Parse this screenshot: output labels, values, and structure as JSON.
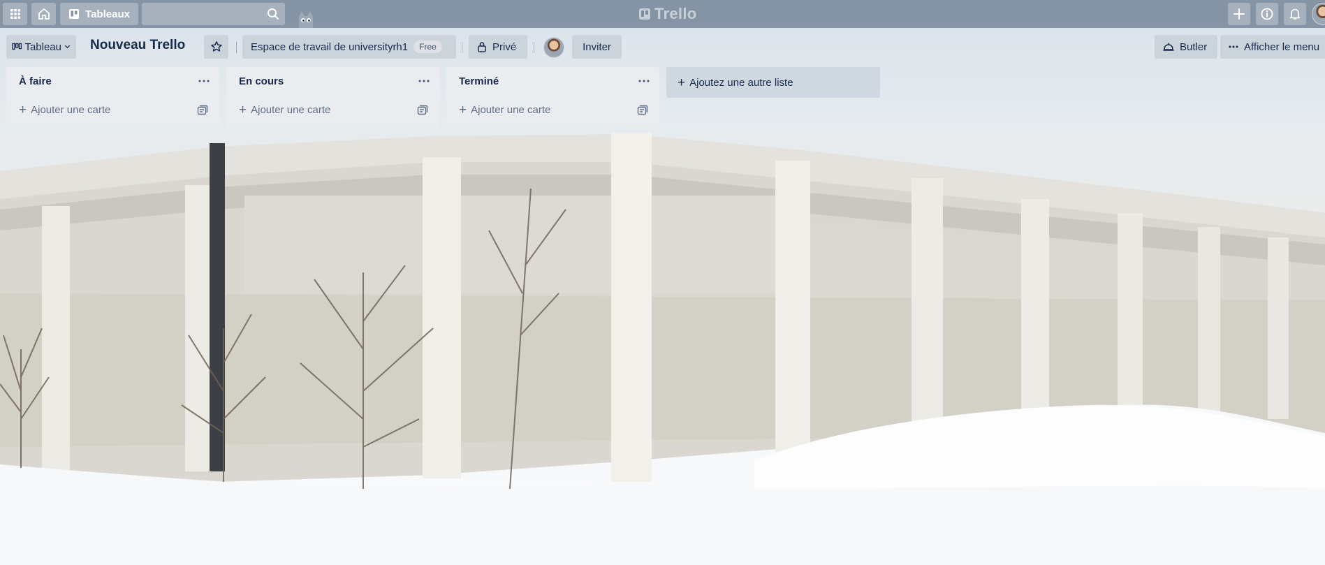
{
  "topbar": {
    "boards_label": "Tableaux",
    "search_value": "",
    "logo_text": "Trello",
    "icons": [
      "apps-grid-icon",
      "home-icon",
      "boards-icon",
      "search-icon",
      "create-plus-icon",
      "info-icon",
      "notifications-bell-icon"
    ]
  },
  "board_header": {
    "view_label": "Tableau",
    "title": "Nouveau Trello",
    "workspace_label": "Espace de travail de universityrh1",
    "workspace_badge": "Free",
    "visibility_label": "Privé",
    "invite_label": "Inviter",
    "butler_label": "Butler",
    "show_menu_label": "Afficher le menu"
  },
  "lists": [
    {
      "title": "À faire",
      "add_card_label": "Ajouter une carte"
    },
    {
      "title": "En cours",
      "add_card_label": "Ajouter une carte"
    },
    {
      "title": "Terminé",
      "add_card_label": "Ajouter une carte"
    }
  ],
  "add_list_label": "Ajoutez une autre liste",
  "colors": {
    "topbar_bg": "#7e8d9e",
    "list_bg": "#ebecf0",
    "text_primary": "#172b4d",
    "text_secondary": "#5e6c84"
  }
}
